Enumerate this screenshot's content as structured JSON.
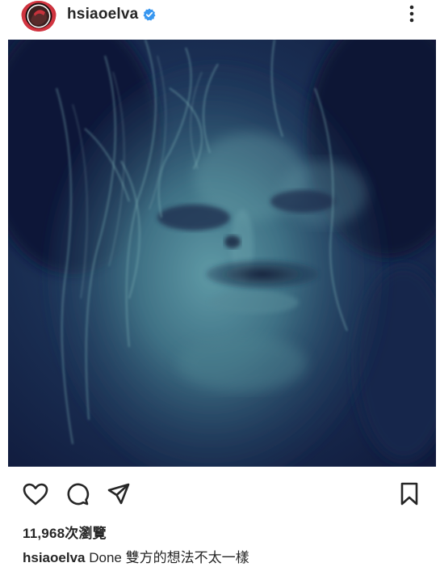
{
  "post": {
    "username": "hsiaoelva",
    "views": "11,968次瀏覽",
    "caption_user": "hsiaoelva",
    "caption_text": " Done 雙方的想法不太一樣"
  },
  "icons": {
    "verified": "verified-badge-icon",
    "more": "more-vertical-icon",
    "like": "heart-icon",
    "comment": "comment-icon",
    "share": "send-icon",
    "save": "bookmark-icon"
  },
  "colors": {
    "verified_blue": "#3897f0",
    "text": "#262626",
    "photo_tint": "#1b2a5a"
  }
}
